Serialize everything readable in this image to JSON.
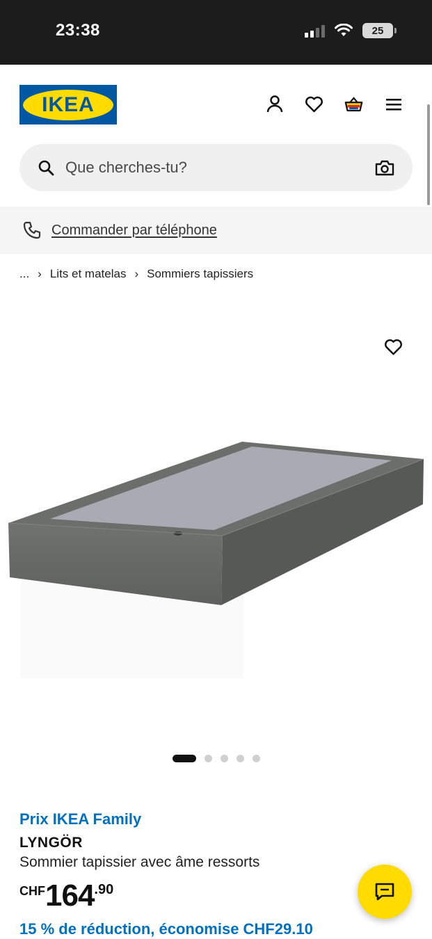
{
  "status_bar": {
    "time": "23:38",
    "battery": "25"
  },
  "header": {
    "logo_text": "IKEA",
    "brand_blue": "#0058a3",
    "brand_yellow": "#ffdb00"
  },
  "search": {
    "placeholder": "Que cherches-tu?"
  },
  "phone_order": {
    "label": "Commander par téléphone"
  },
  "breadcrumb": {
    "ellipsis": "...",
    "items": [
      "Lits et matelas",
      "Sommiers tapissiers"
    ]
  },
  "gallery": {
    "slide_count": 5,
    "active_index": 0
  },
  "product": {
    "family_label": "Prix IKEA Family",
    "name": "LYNGÖR",
    "description": "Sommier tapissier avec âme ressorts",
    "price_currency": "CHF",
    "price_integer": "164",
    "price_decimal": ".90",
    "discount": "15 % de réduction, économise CHF29.10"
  },
  "colors": {
    "family_blue": "#0070c0",
    "chat_yellow": "#ffdb00"
  }
}
